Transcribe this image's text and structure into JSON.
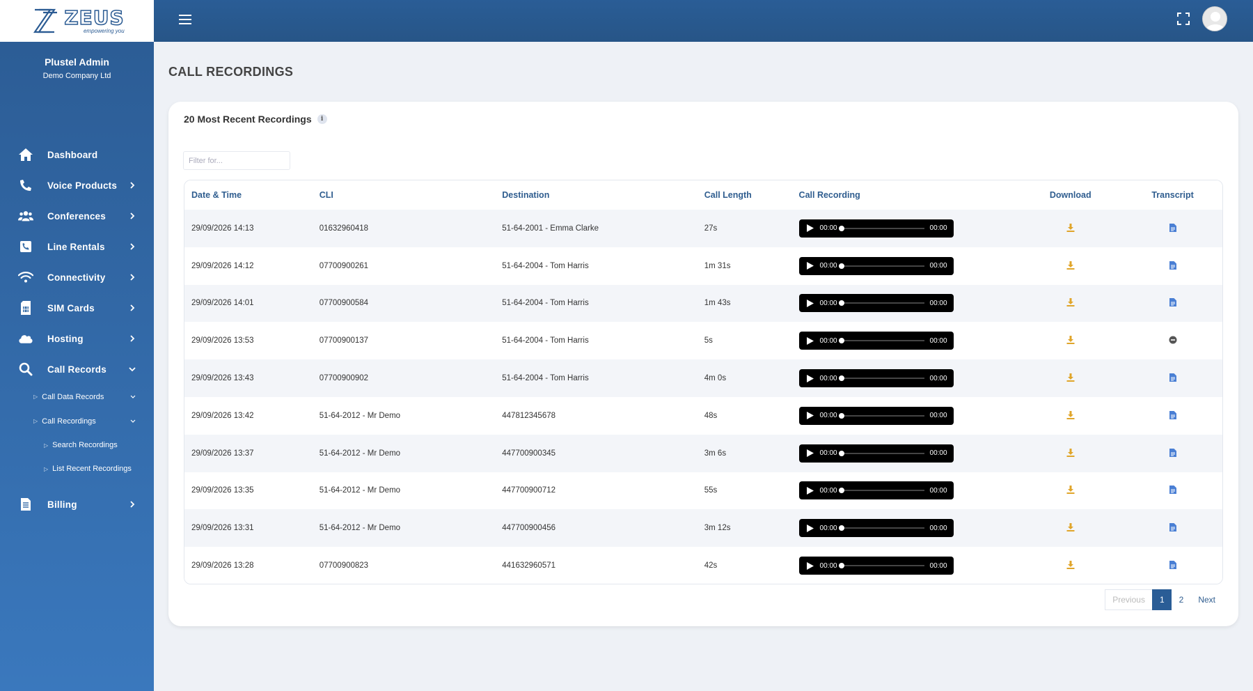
{
  "brand": {
    "name": "ZEUS",
    "tagline": "empowering you"
  },
  "user": {
    "name": "Plustel Admin",
    "company": "Demo Company Ltd"
  },
  "sidebar": {
    "items": [
      {
        "label": "Dashboard",
        "icon": "home-icon"
      },
      {
        "label": "Voice Products",
        "icon": "phone-icon"
      },
      {
        "label": "Conferences",
        "icon": "users-icon"
      },
      {
        "label": "Line Rentals",
        "icon": "phone-square-icon"
      },
      {
        "label": "Connectivity",
        "icon": "wifi-icon"
      },
      {
        "label": "SIM Cards",
        "icon": "sim-card-icon"
      },
      {
        "label": "Hosting",
        "icon": "cloud-icon"
      },
      {
        "label": "Call Records",
        "icon": "search-icon"
      },
      {
        "label": "Billing",
        "icon": "invoice-icon"
      }
    ],
    "call_records_sub": [
      {
        "label": "Call Data Records"
      },
      {
        "label": "Call Recordings"
      }
    ],
    "call_recordings_sub": [
      {
        "label": "Search Recordings"
      },
      {
        "label": "List Recent Recordings"
      }
    ]
  },
  "page": {
    "title": "CALL RECORDINGS",
    "card_title": "20 Most Recent Recordings",
    "filter_placeholder": "Filter for..."
  },
  "table": {
    "headers": [
      "Date & Time",
      "CLI",
      "Destination",
      "Call Length",
      "Call Recording",
      "Download",
      "Transcript"
    ],
    "rows": [
      {
        "datetime": "29/09/2026 14:13",
        "cli": "01632960418",
        "destination": "51-64-2001 - Emma Clarke",
        "length": "27s",
        "cur": "00:00",
        "dur": "00:00",
        "transcript": "document"
      },
      {
        "datetime": "29/09/2026 14:12",
        "cli": "07700900261",
        "destination": "51-64-2004 - Tom Harris",
        "length": "1m 31s",
        "cur": "00:00",
        "dur": "00:00",
        "transcript": "document"
      },
      {
        "datetime": "29/09/2026 14:01",
        "cli": "07700900584",
        "destination": "51-64-2004 - Tom Harris",
        "length": "1m 43s",
        "cur": "00:00",
        "dur": "00:00",
        "transcript": "document"
      },
      {
        "datetime": "29/09/2026 13:53",
        "cli": "07700900137",
        "destination": "51-64-2004 - Tom Harris",
        "length": "5s",
        "cur": "00:00",
        "dur": "00:00",
        "transcript": "none"
      },
      {
        "datetime": "29/09/2026 13:43",
        "cli": "07700900902",
        "destination": "51-64-2004 - Tom Harris",
        "length": "4m 0s",
        "cur": "00:00",
        "dur": "00:00",
        "transcript": "document"
      },
      {
        "datetime": "29/09/2026 13:42",
        "cli": "51-64-2012 - Mr Demo",
        "destination": "447812345678",
        "length": "48s",
        "cur": "00:00",
        "dur": "00:00",
        "transcript": "document"
      },
      {
        "datetime": "29/09/2026 13:37",
        "cli": "51-64-2012 - Mr Demo",
        "destination": "447700900345",
        "length": "3m 6s",
        "cur": "00:00",
        "dur": "00:00",
        "transcript": "document"
      },
      {
        "datetime": "29/09/2026 13:35",
        "cli": "51-64-2012 - Mr Demo",
        "destination": "447700900712",
        "length": "55s",
        "cur": "00:00",
        "dur": "00:00",
        "transcript": "document"
      },
      {
        "datetime": "29/09/2026 13:31",
        "cli": "51-64-2012 - Mr Demo",
        "destination": "447700900456",
        "length": "3m 12s",
        "cur": "00:00",
        "dur": "00:00",
        "transcript": "document"
      },
      {
        "datetime": "29/09/2026 13:28",
        "cli": "07700900823",
        "destination": "441632960571",
        "length": "42s",
        "cur": "00:00",
        "dur": "00:00",
        "transcript": "document"
      }
    ]
  },
  "pagination": {
    "previous": "Previous",
    "pages": [
      "1",
      "2"
    ],
    "next": "Next",
    "current": "1"
  },
  "colors": {
    "primary": "#2a5d96",
    "download": "#e0a52a",
    "transcript": "#4a7fd4"
  }
}
